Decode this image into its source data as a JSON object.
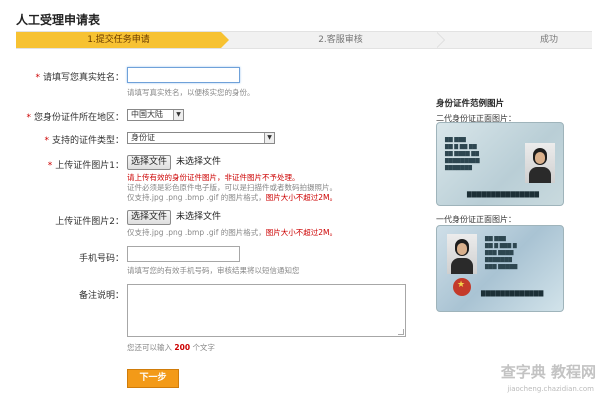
{
  "page": {
    "title": "人工受理申请表"
  },
  "steps": [
    {
      "label": "1.提交任务申请",
      "state": "active"
    },
    {
      "label": "2.客服审核",
      "state": "pending"
    },
    {
      "label": "成功",
      "state": "pending"
    }
  ],
  "form": {
    "name": {
      "label": "请填写您真实姓名：",
      "required": true,
      "value": "",
      "hint": "请填写真实姓名，以便核实您的身份。"
    },
    "region": {
      "label": "您身份证件所在地区：",
      "required": true,
      "selected": "中国大陆"
    },
    "doc_type": {
      "label": "支持的证件类型：",
      "required": true,
      "selected": "身份证"
    },
    "image1": {
      "label": "上传证件图片1：",
      "required": true,
      "button": "选择文件",
      "status": "未选择文件",
      "warning": "请上传有效的身份证件图片，非证件图片不予处理。",
      "hint_line1": "证件必须是彩色原件电子版，可以是扫描件或者数码拍摄照片。",
      "hint_line2_prefix": "仅支持.jpg .png .bmp .gif 的图片格式，",
      "hint_line2_warn": "图片大小不超过2M。"
    },
    "image2": {
      "label": "上传证件图片2：",
      "required": false,
      "button": "选择文件",
      "status": "未选择文件",
      "hint_prefix": "仅支持.jpg .png .bmp .gif 的图片格式，",
      "hint_warn": "图片大小不超过2M。"
    },
    "phone": {
      "label": "手机号码：",
      "value": "",
      "hint": "请填写您的有效手机号码，审核结果将以短信通知您"
    },
    "notes": {
      "label": "备注说明：",
      "value": "",
      "counter_prefix": "您还可以输入",
      "counter_value": "200",
      "counter_suffix": "个文字"
    },
    "submit_label": "下一步"
  },
  "sidebar": {
    "title": "身份证件范例图片",
    "second_gen_caption": "二代身份证正面图片：",
    "first_gen_caption": "一代身份证正面图片："
  },
  "colors": {
    "accent": "#f7c232",
    "button": "#f39a18",
    "required": "#cc0000",
    "link": "#c00000"
  },
  "watermark": {
    "text": "查字典 教程网",
    "sub": "jiaocheng.chazidian.com"
  }
}
